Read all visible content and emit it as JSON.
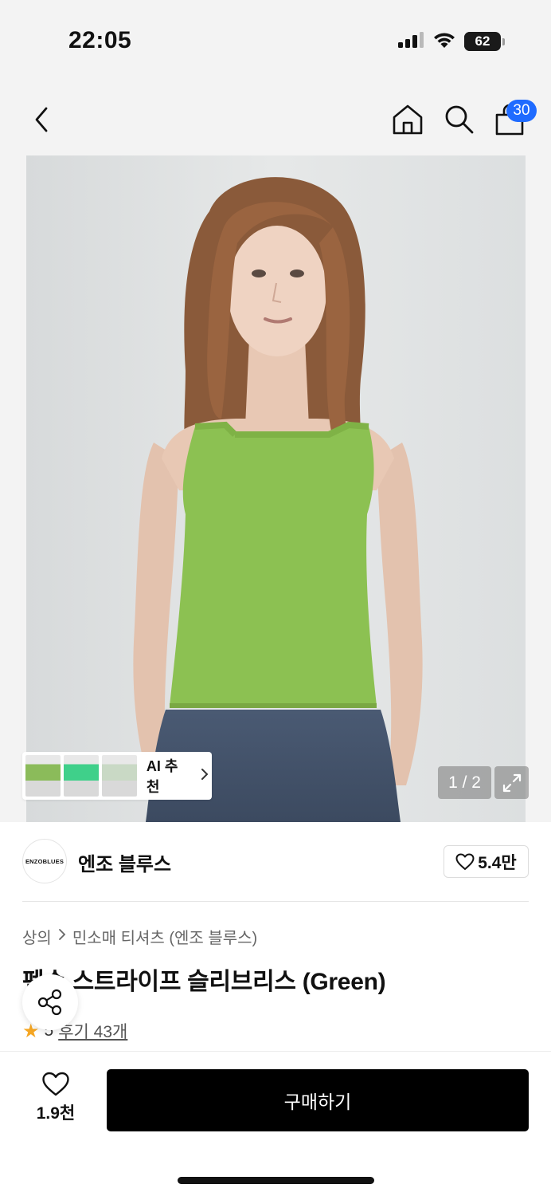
{
  "status_bar": {
    "time": "22:05",
    "battery": "62",
    "battery_percent": 62,
    "icons": [
      "cellular-signal-icon",
      "wifi-icon",
      "battery-icon"
    ]
  },
  "nav": {
    "cart_count": "30",
    "icons": [
      "back-chevron-icon",
      "home-icon",
      "search-icon",
      "shopping-bag-icon"
    ],
    "badge_color": "#1f6bff"
  },
  "gallery": {
    "page_indicator": "1 / 2",
    "current_page": 1,
    "total_pages": 2,
    "ai_recommend_label": "AI 추천",
    "ai_thumbnail_colors": [
      "#8bbb5a",
      "#3fd08a",
      "#c9d9c5"
    ]
  },
  "brand": {
    "logo_text": "ENZOBLUES",
    "name": "엔조 블루스",
    "like_count": "5.4만"
  },
  "product": {
    "breadcrumb": [
      "상의",
      "민소매 티셔츠 (엔조 블루스)"
    ],
    "title": "펜슨 스트라이프 슬리브리스 (Green)",
    "rating": "5",
    "review_link": "후기 43개"
  },
  "bottom_bar": {
    "wish_count": "1.9천",
    "buy_label": "구매하기"
  },
  "colors": {
    "accent": "#1f6bff",
    "buy_button": "#000000",
    "star": "#f5a623",
    "top_color": "#8cc152"
  }
}
